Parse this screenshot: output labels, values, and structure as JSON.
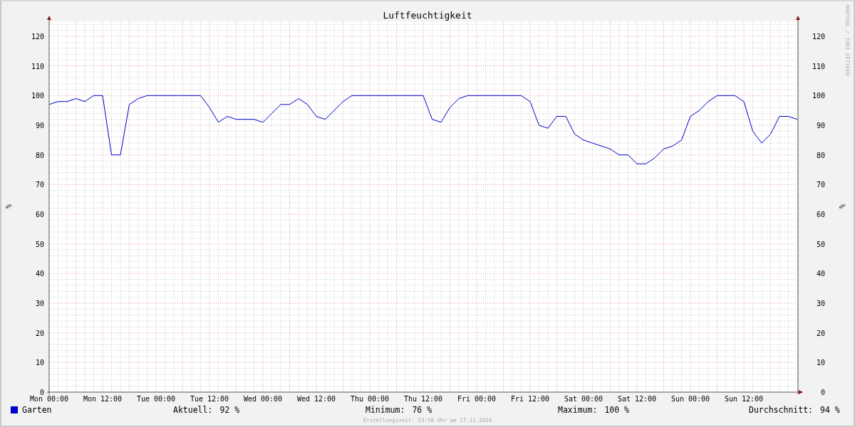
{
  "credit": "RRDTOOL / TOBI OETIKER",
  "chart": {
    "chart_data": {
      "type": "line",
      "title": "Luftfeuchtigkeit",
      "ylabel": "%",
      "ylim": [
        0,
        125
      ],
      "y2lim": [
        0,
        125
      ],
      "grid": true,
      "yticks": [
        0,
        10,
        20,
        30,
        40,
        50,
        60,
        70,
        80,
        90,
        100,
        110,
        120
      ],
      "y2ticks": [
        0,
        10,
        20,
        30,
        40,
        50,
        60,
        70,
        80,
        90,
        100,
        110,
        120
      ],
      "categories": [
        "Mon 00:00",
        null,
        null,
        null,
        null,
        null,
        "Mon 12:00",
        null,
        null,
        null,
        null,
        null,
        "Tue 00:00",
        null,
        null,
        null,
        null,
        null,
        "Tue 12:00",
        null,
        null,
        null,
        null,
        null,
        "Wed 00:00",
        null,
        null,
        null,
        null,
        null,
        "Wed 12:00",
        null,
        null,
        null,
        null,
        null,
        "Thu 00:00",
        null,
        null,
        null,
        null,
        null,
        "Thu 12:00",
        null,
        null,
        null,
        null,
        null,
        "Fri 00:00",
        null,
        null,
        null,
        null,
        null,
        "Fri 12:00",
        null,
        null,
        null,
        null,
        null,
        "Sat 00:00",
        null,
        null,
        null,
        null,
        null,
        "Sat 12:00",
        null,
        null,
        null,
        null,
        null,
        "Sun 00:00",
        null,
        null,
        null,
        null,
        null,
        "Sun 12:00",
        null,
        null,
        null,
        null,
        null,
        null
      ],
      "series": [
        {
          "name": "Garten",
          "color": "#0000cc",
          "values": [
            97,
            98,
            98,
            99,
            98,
            100,
            100,
            80,
            80,
            97,
            99,
            100,
            100,
            100,
            100,
            100,
            100,
            100,
            96,
            91,
            93,
            92,
            92,
            92,
            91,
            94,
            97,
            97,
            99,
            97,
            93,
            92,
            95,
            98,
            100,
            100,
            100,
            100,
            100,
            100,
            100,
            100,
            100,
            92,
            91,
            96,
            99,
            100,
            100,
            100,
            100,
            100,
            100,
            100,
            98,
            90,
            89,
            93,
            93,
            87,
            85,
            84,
            83,
            82,
            80,
            80,
            77,
            77,
            79,
            82,
            83,
            85,
            93,
            95,
            98,
            100,
            100,
            100,
            98,
            88,
            84,
            87,
            93,
            93,
            92
          ]
        }
      ]
    }
  },
  "legend": {
    "stats": [
      {
        "label": "Aktuell:",
        "value": "92 %"
      },
      {
        "label": "Minimum:",
        "value": "76 %"
      },
      {
        "label": "Maximum:",
        "value": "100 %"
      },
      {
        "label": "Durchschnitt:",
        "value": "94 %"
      }
    ]
  },
  "footer": "Erstellungszeit: 23:58 Uhr am 17.11.2024"
}
